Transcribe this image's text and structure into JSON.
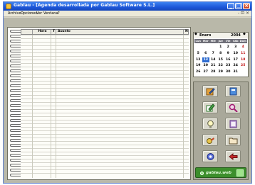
{
  "window": {
    "title": "Gablau  - [Agenda desarrollada por Gablau Software S.L.]"
  },
  "titlebar_buttons": {
    "minimize": "_",
    "maximize": "□",
    "close": "×"
  },
  "menu": {
    "items": [
      "Archivo",
      "Opciones",
      "Ver",
      "Ventana",
      "?"
    ],
    "mdi_controls": "- ⊡ ×"
  },
  "agenda": {
    "columns": {
      "hora": "Hora",
      "t": "T",
      "asunto": "Asunto",
      "n": "N"
    },
    "rows": []
  },
  "calendar": {
    "month": "Enero",
    "year": "2004",
    "spin": "◆",
    "day_names": [
      "Lun",
      "Mar",
      "Mié",
      "Jue",
      "Vie",
      "Sáb",
      "Dom"
    ],
    "weeks": [
      [
        "",
        "",
        "",
        "1",
        "2",
        "3",
        "4"
      ],
      [
        "5",
        "6",
        "7",
        "8",
        "9",
        "10",
        "11"
      ],
      [
        "12",
        "13",
        "14",
        "15",
        "16",
        "17",
        "18"
      ],
      [
        "19",
        "20",
        "21",
        "22",
        "23",
        "24",
        "25"
      ],
      [
        "26",
        "27",
        "28",
        "29",
        "30",
        "31",
        ""
      ]
    ],
    "selected": "13"
  },
  "tool_buttons": [
    {
      "icon": "edit-note-icon"
    },
    {
      "icon": "book-icon"
    },
    {
      "icon": "pencil-note-icon"
    },
    {
      "icon": "magnifier-icon"
    },
    {
      "icon": "lightbulb-icon"
    },
    {
      "icon": "calendar-grid-icon"
    },
    {
      "icon": "tools-icon"
    },
    {
      "icon": "folder-icon"
    },
    {
      "icon": "settings-icon"
    },
    {
      "icon": "exit-arrows-icon"
    }
  ],
  "brand": {
    "label": "gablau.web"
  },
  "colors": {
    "titlebar": "#1c55d8",
    "accent_today": "#2d6bd0",
    "brand": "#3c8e2c",
    "sunday": "#c01010"
  }
}
